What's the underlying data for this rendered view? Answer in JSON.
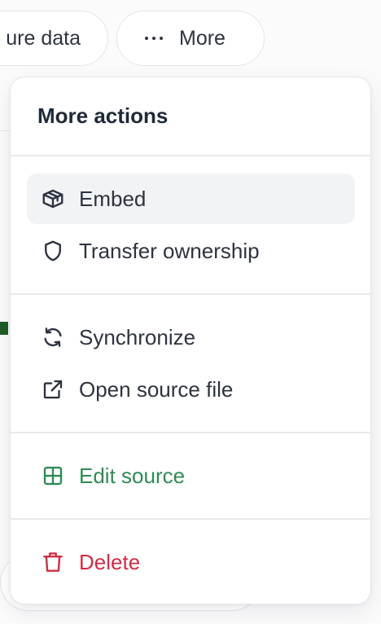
{
  "toolbar": {
    "left_pill_label": "ure data",
    "more_label": "More"
  },
  "menu": {
    "title": "More actions",
    "items": [
      {
        "label": "Embed",
        "icon": "box-icon"
      },
      {
        "label": "Transfer ownership",
        "icon": "shield-icon"
      },
      {
        "label": "Synchronize",
        "icon": "sync-icon"
      },
      {
        "label": "Open source file",
        "icon": "external-link-icon"
      },
      {
        "label": "Edit source",
        "icon": "grid-icon",
        "color": "#2f8a55"
      },
      {
        "label": "Delete",
        "icon": "trash-icon",
        "color": "#d12c45"
      }
    ]
  }
}
